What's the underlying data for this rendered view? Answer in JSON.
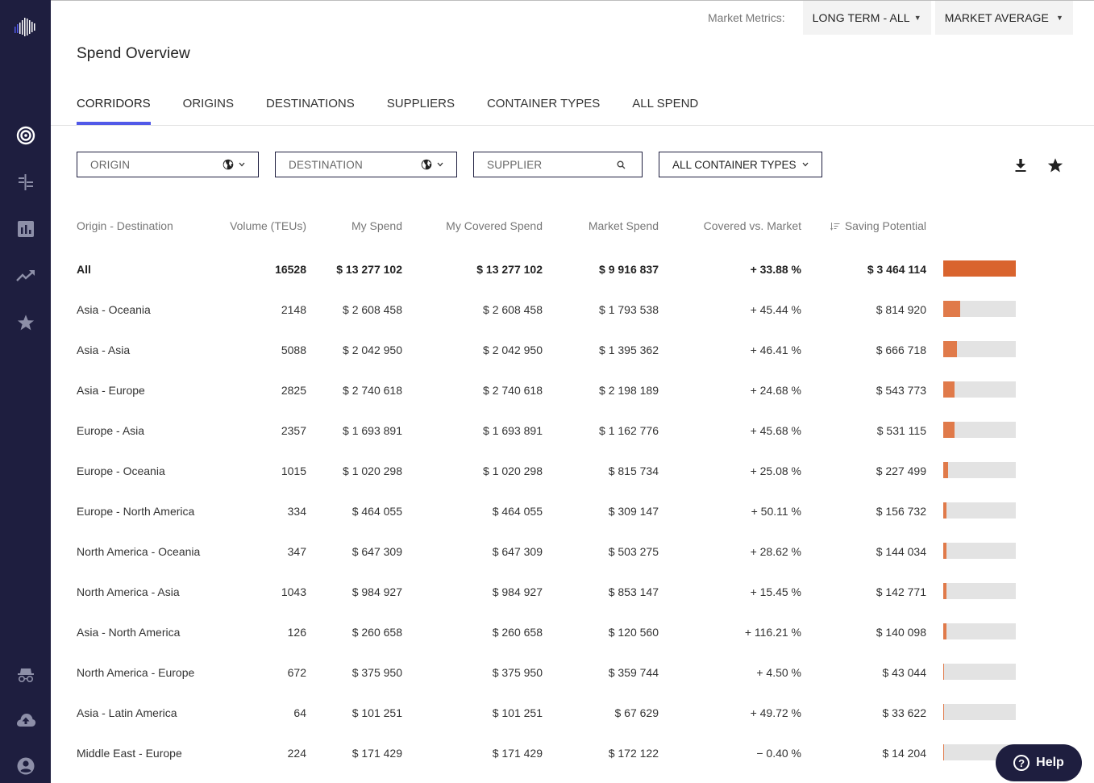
{
  "header": {
    "metrics_label": "Market Metrics:",
    "term_dropdown": "LONG TERM - ALL",
    "average_dropdown": "MARKET AVERAGE",
    "page_title": "Spend Overview"
  },
  "sidebar": {
    "items": [
      {
        "icon": "logo-icon"
      },
      {
        "icon": "target-icon"
      },
      {
        "icon": "routes-icon"
      },
      {
        "icon": "bar-chart-icon"
      },
      {
        "icon": "trending-up-icon"
      },
      {
        "icon": "star-icon"
      },
      {
        "icon": "incognito-icon"
      },
      {
        "icon": "cloud-upload-icon"
      },
      {
        "icon": "account-icon"
      }
    ]
  },
  "tabs": [
    {
      "label": "CORRIDORS",
      "active": true
    },
    {
      "label": "ORIGINS",
      "active": false
    },
    {
      "label": "DESTINATIONS",
      "active": false
    },
    {
      "label": "SUPPLIERS",
      "active": false
    },
    {
      "label": "CONTAINER TYPES",
      "active": false
    },
    {
      "label": "ALL SPEND",
      "active": false
    }
  ],
  "filters": {
    "origin": "ORIGIN",
    "destination": "DESTINATION",
    "supplier_placeholder": "SUPPLIER",
    "container_types": "ALL CONTAINER TYPES"
  },
  "table": {
    "columns": [
      "Origin - Destination",
      "Volume (TEUs)",
      "My Spend",
      "My Covered Spend",
      "Market Spend",
      "Covered vs. Market",
      "Saving Potential"
    ],
    "sorted_column": "Saving Potential",
    "total": {
      "corridor": "All",
      "volume": "16528",
      "my_spend": "$ 13 277 102",
      "covered_spend": "$ 13 277 102",
      "market_spend": "$ 9 916 837",
      "covered_vs_market": "+ 33.88 %",
      "saving_potential": "$ 3 464 114",
      "saving_fraction": 1.0
    },
    "rows": [
      {
        "corridor": "Asia - Oceania",
        "volume": "2148",
        "my_spend": "$ 2 608 458",
        "covered_spend": "$ 2 608 458",
        "market_spend": "$ 1 793 538",
        "covered_vs_market": "+ 45.44 %",
        "saving_potential": "$ 814 920",
        "saving_fraction": 0.2352
      },
      {
        "corridor": "Asia - Asia",
        "volume": "5088",
        "my_spend": "$ 2 042 950",
        "covered_spend": "$ 2 042 950",
        "market_spend": "$ 1 395 362",
        "covered_vs_market": "+ 46.41 %",
        "saving_potential": "$ 666 718",
        "saving_fraction": 0.1925
      },
      {
        "corridor": "Asia - Europe",
        "volume": "2825",
        "my_spend": "$ 2 740 618",
        "covered_spend": "$ 2 740 618",
        "market_spend": "$ 2 198 189",
        "covered_vs_market": "+ 24.68 %",
        "saving_potential": "$ 543 773",
        "saving_fraction": 0.157
      },
      {
        "corridor": "Europe - Asia",
        "volume": "2357",
        "my_spend": "$ 1 693 891",
        "covered_spend": "$ 1 693 891",
        "market_spend": "$ 1 162 776",
        "covered_vs_market": "+ 45.68 %",
        "saving_potential": "$ 531 115",
        "saving_fraction": 0.1533
      },
      {
        "corridor": "Europe - Oceania",
        "volume": "1015",
        "my_spend": "$ 1 020 298",
        "covered_spend": "$ 1 020 298",
        "market_spend": "$ 815 734",
        "covered_vs_market": "+ 25.08 %",
        "saving_potential": "$ 227 499",
        "saving_fraction": 0.0657
      },
      {
        "corridor": "Europe - North America",
        "volume": "334",
        "my_spend": "$ 464 055",
        "covered_spend": "$ 464 055",
        "market_spend": "$ 309 147",
        "covered_vs_market": "+ 50.11 %",
        "saving_potential": "$ 156 732",
        "saving_fraction": 0.0452
      },
      {
        "corridor": "North America - Oceania",
        "volume": "347",
        "my_spend": "$ 647 309",
        "covered_spend": "$ 647 309",
        "market_spend": "$ 503 275",
        "covered_vs_market": "+ 28.62 %",
        "saving_potential": "$ 144 034",
        "saving_fraction": 0.0416
      },
      {
        "corridor": "North America - Asia",
        "volume": "1043",
        "my_spend": "$ 984 927",
        "covered_spend": "$ 984 927",
        "market_spend": "$ 853 147",
        "covered_vs_market": "+ 15.45 %",
        "saving_potential": "$ 142 771",
        "saving_fraction": 0.0412
      },
      {
        "corridor": "Asia - North America",
        "volume": "126",
        "my_spend": "$ 260 658",
        "covered_spend": "$ 260 658",
        "market_spend": "$ 120 560",
        "covered_vs_market": "+ 116.21 %",
        "saving_potential": "$ 140 098",
        "saving_fraction": 0.0404
      },
      {
        "corridor": "North America - Europe",
        "volume": "672",
        "my_spend": "$ 375 950",
        "covered_spend": "$ 375 950",
        "market_spend": "$ 359 744",
        "covered_vs_market": "+ 4.50 %",
        "saving_potential": "$ 43 044",
        "saving_fraction": 0.0124
      },
      {
        "corridor": "Asia - Latin America",
        "volume": "64",
        "my_spend": "$ 101 251",
        "covered_spend": "$ 101 251",
        "market_spend": "$ 67 629",
        "covered_vs_market": "+ 49.72 %",
        "saving_potential": "$ 33 622",
        "saving_fraction": 0.0097
      },
      {
        "corridor": "Middle East - Europe",
        "volume": "224",
        "my_spend": "$ 171 429",
        "covered_spend": "$ 171 429",
        "market_spend": "$ 172 122",
        "covered_vs_market": "− 0.40 %",
        "saving_potential": "$ 14 204",
        "saving_fraction": 0.0041
      }
    ]
  },
  "help": {
    "label": "Help"
  },
  "colors": {
    "sidebar": "#1e1e3f",
    "accent": "#5159e8",
    "bar_fill": "#e07a4a",
    "bar_total": "#d9642e",
    "bar_track": "#e3e3e3"
  }
}
